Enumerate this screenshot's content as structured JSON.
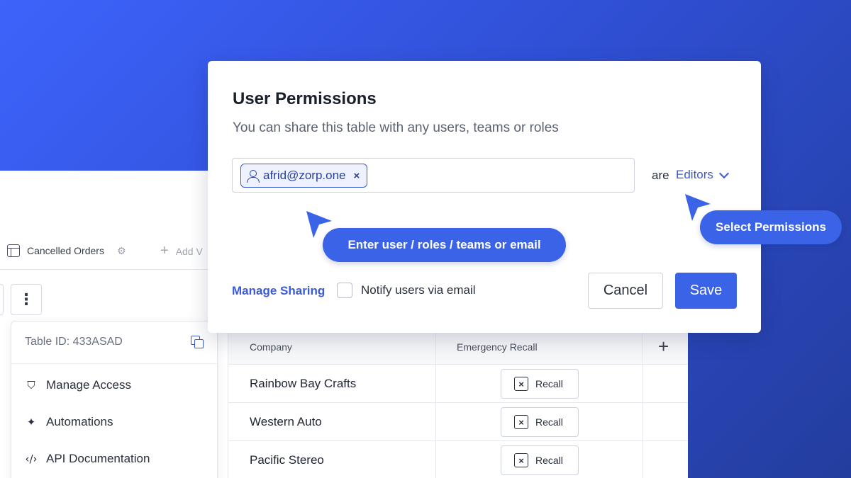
{
  "colors": {
    "accent": "#3b63e8",
    "link": "#3b5ad8",
    "background_gradient_start": "#3d63fb",
    "background_gradient_end": "#233d9e"
  },
  "background_app": {
    "tab": {
      "label": "Cancelled Orders",
      "icon": "table-icon",
      "settings_icon": "gear-icon"
    },
    "add_view": {
      "label": "Add V",
      "icon": "plus-icon"
    },
    "more_button_icon": "kebab-icon",
    "dropdown_menu": {
      "table_id": "Table ID: 433ASAD",
      "copy_icon": "copy-icon",
      "items": [
        {
          "label": "Manage Access",
          "icon": "shield-icon"
        },
        {
          "label": "Automations",
          "icon": "sparkle-icon"
        },
        {
          "label": "API Documentation",
          "icon": "code-icon"
        }
      ]
    },
    "table": {
      "columns": [
        "Company",
        "Emergency Recall"
      ],
      "add_column_icon": "plus-icon",
      "rows": [
        {
          "company": "Rainbow Bay Crafts",
          "action": "Recall"
        },
        {
          "company": "Western Auto",
          "action": "Recall"
        },
        {
          "company": "Pacific Stereo",
          "action": "Recall"
        }
      ]
    }
  },
  "modal": {
    "title": "User Permissions",
    "subtitle": "You can share this table with any users, teams or roles",
    "chip": {
      "email": "afrid@zorp.one",
      "icon": "user-icon",
      "remove": "×"
    },
    "are_label": "are",
    "role_value": "Editors",
    "manage_sharing": "Manage Sharing",
    "notify_label": "Notify users via email",
    "notify_checked": false,
    "cancel_label": "Cancel",
    "save_label": "Save"
  },
  "callouts": {
    "input_hint": "Enter user / roles / teams or email",
    "permissions_hint": "Select Permissions"
  }
}
